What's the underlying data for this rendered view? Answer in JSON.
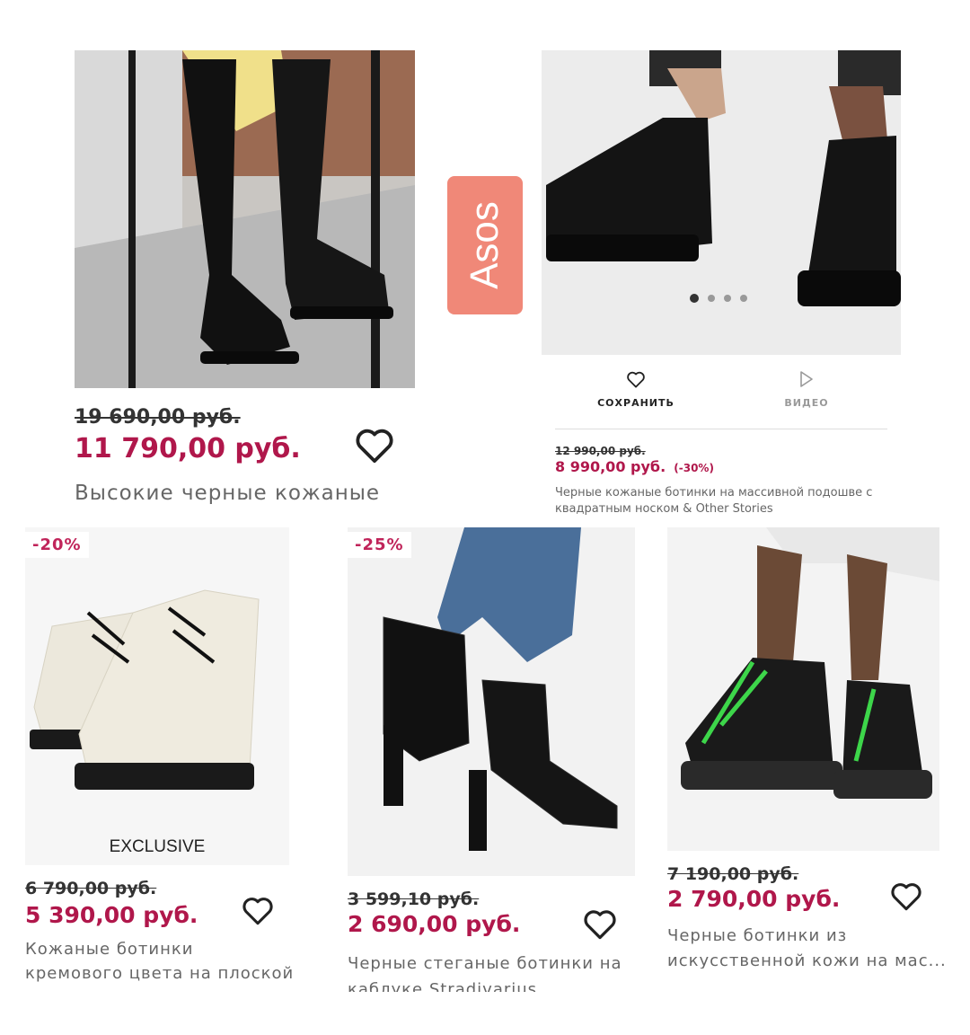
{
  "brand_tag": "Asos",
  "products": [
    {
      "old_price": "19 690,00 руб.",
      "new_price": "11 790,00 руб.",
      "description": "Высокие черные кожаные"
    },
    {
      "old_price": "12 990,00 руб.",
      "new_price": "8 990,00 руб.",
      "discount": "(-30%)",
      "description": "Черные кожаные ботинки на массивной подошве с квадратным носком & Other Stories",
      "save_label": "СОХРАНИТЬ",
      "video_label": "ВИДЕО",
      "carousel": {
        "count": 4,
        "active": 1
      }
    },
    {
      "badge": "-20%",
      "image_label": "EXCLUSIVE",
      "old_price": "6 790,00 руб.",
      "new_price": "5 390,00 руб.",
      "description": "Кожаные ботинки кремового цвета на плоской подошве..."
    },
    {
      "badge": "-25%",
      "old_price": "3 599,10 руб.",
      "new_price": "2 690,00 руб.",
      "description": "Черные стеганые ботинки на каблуке Stradivarius"
    },
    {
      "old_price": "7 190,00 руб.",
      "new_price": "2 790,00 руб.",
      "description": "Черные ботинки из искусственной кожи на мас..."
    }
  ],
  "colors": {
    "sale": "#b0174b",
    "brand_tag": "#f08878"
  }
}
